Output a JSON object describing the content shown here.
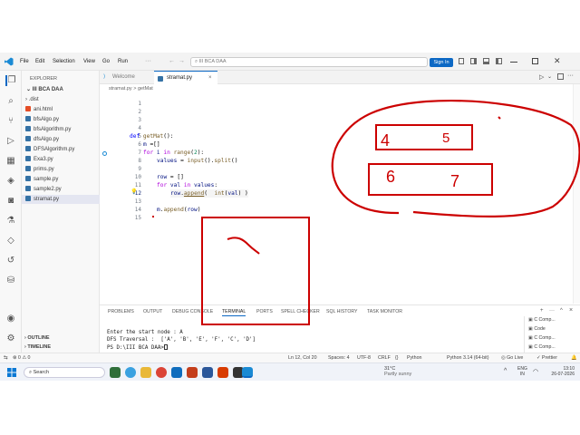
{
  "window": {
    "command_center": "III BCA DAA",
    "sign_in": "Sign In"
  },
  "menu": [
    "File",
    "Edit",
    "Selection",
    "View",
    "Go",
    "Run"
  ],
  "explorer": {
    "title": "EXPLORER",
    "folder": "III BCA DAA",
    "items": [
      ".dist",
      "ani.html",
      "bfsAlgo.py",
      "bfsAlgorithm.py",
      "dfsAlgo.py",
      "DFSAlgorithm.py",
      "Exa3.py",
      "prims.py",
      "sample.py",
      "sample2.py",
      "stramat.py"
    ],
    "outline": "OUTLINE",
    "timeline": "TIMELINE"
  },
  "tabs": [
    {
      "label": "Welcome"
    },
    {
      "label": "stramat.py"
    }
  ],
  "breadcrumb": {
    "file": "stramat.py",
    "sep": ">",
    "symbol": "getMat"
  },
  "line_numbers": [
    "1",
    "2",
    "3",
    "4",
    "5",
    "6",
    "7",
    "8",
    "9",
    "10",
    "11",
    "12",
    "13",
    "14",
    "15"
  ],
  "annotations": {
    "r1a": "4",
    "r1b": "5",
    "r2a": "6",
    "r2b": "7"
  },
  "panel": {
    "tabs": [
      "PROBLEMS",
      "OUTPUT",
      "DEBUG CONSOLE",
      "TERMINAL",
      "PORTS",
      "SPELL CHECKER",
      "SQL HISTORY",
      "TASK MONITOR"
    ],
    "terminal": [
      "Enter the start node : A",
      "DFS Traversal :  ['A', 'B', 'E', 'F', 'C', 'D']",
      "PS D:\\III BCA DAA>"
    ],
    "sessions": [
      "C Comp...",
      "Code",
      "C Comp...",
      "C Comp..."
    ]
  },
  "status": {
    "left": "⊗ 0 ⚠ 0",
    "position": "Ln 12, Col 20",
    "spaces": "Spaces: 4",
    "encoding": "UTF-8",
    "eol": "CRLF",
    "lang": "Python",
    "interpreter": "Python 3.14 (64-bit)",
    "golive": "Go Live",
    "prettier": "Prettier"
  },
  "taskbar": {
    "search": "Search",
    "weather_temp": "31°C",
    "weather_desc": "Partly sunny",
    "lang1": "ENG",
    "lang2": "IN",
    "time": "13:10",
    "date": "26-07-2026"
  },
  "colors": {
    "accent": "#0c68c4",
    "ink": "#cc0000"
  }
}
